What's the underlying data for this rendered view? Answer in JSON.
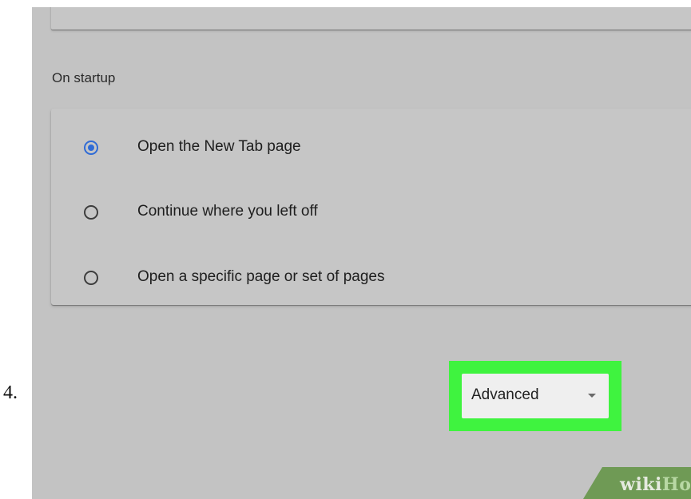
{
  "step": {
    "number": "4."
  },
  "settings": {
    "on_startup": {
      "title": "On startup",
      "options": [
        {
          "label": "Open the New Tab page",
          "selected": true
        },
        {
          "label": "Continue where you left off",
          "selected": false
        },
        {
          "label": "Open a specific page or set of pages",
          "selected": false
        }
      ]
    },
    "advanced": {
      "label": "Advanced",
      "icon": "chevron-down-icon",
      "highlight_color": "#3ff33f"
    }
  },
  "watermark": {
    "wiki": "wiki",
    "how": "How"
  },
  "colors": {
    "radio_selected": "#2f6bd6",
    "background": "#c3c3c3"
  }
}
